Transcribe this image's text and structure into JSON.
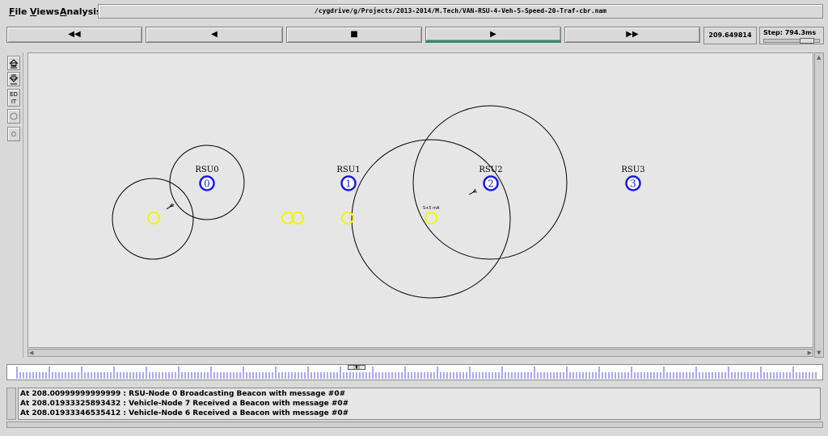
{
  "menu": {
    "file_first": "F",
    "file_rest": "ile",
    "views_first": "V",
    "views_rest": "iews",
    "analysis_first": "A",
    "analysis_rest": "nalysis"
  },
  "window_title": "/cygdrive/g/Projects/2013-2014/M.Tech/VAN-RSU-4-Veh-5-Speed-20-Traf-cbr.nam",
  "transport": {
    "rewind": "◀◀",
    "back": "◀",
    "stop": "■",
    "play": "▶",
    "fast_forward": "▶▶"
  },
  "time_display": "209.649814",
  "step_label": "Step: 794.3ms",
  "tools": {
    "edit_label": "ED IT"
  },
  "rsus": [
    {
      "label": "RSU0",
      "id": "0"
    },
    {
      "label": "RSU1",
      "id": "1"
    },
    {
      "label": "RSU2",
      "id": "2"
    },
    {
      "label": "RSU3",
      "id": "3"
    }
  ],
  "packet_label": "S+5 mA",
  "colors": {
    "rsu_node": "#1a1ae0",
    "vehicle_node": "#f5f500",
    "canvas_bg": "#e6e6e6",
    "play_accent": "#2e8a6c"
  },
  "timeline_marker": "▯▮▯",
  "log": [
    "At 208.00999999999999 : RSU-Node 0 Broadcasting Beacon with message #0#",
    "At 208.01933325893432 : Vehicle-Node 7 Received a Beacon with message #0#",
    "At 208.01933346535412 : Vehicle-Node 6 Received a Beacon with message #0#"
  ]
}
